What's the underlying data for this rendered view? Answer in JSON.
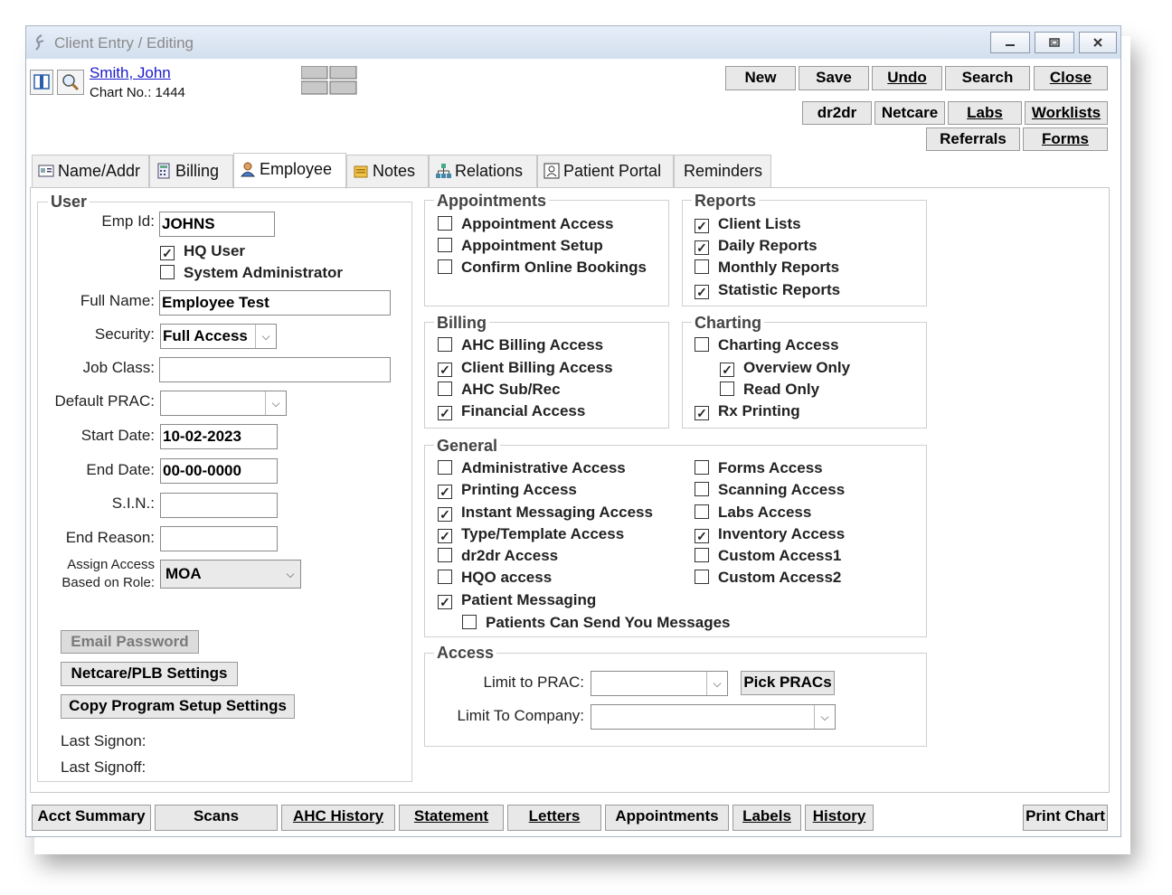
{
  "window": {
    "title": "Client Entry / Editing"
  },
  "client": {
    "name": "Smith, John",
    "chart_label": "Chart No.: 1444"
  },
  "toolbar": {
    "row1": [
      "New",
      "Save",
      "Undo",
      "Search",
      "Close"
    ],
    "row2": [
      "dr2dr",
      "Netcare",
      "Labs",
      "Worklists"
    ],
    "row3": [
      "Referrals",
      "Forms"
    ]
  },
  "tabs": [
    "Name/Addr",
    "Billing",
    "Employee",
    "Notes",
    "Relations",
    "Patient Portal",
    "Reminders"
  ],
  "user": {
    "title": "User",
    "emp_id_label": "Emp Id:",
    "emp_id": "JOHNS",
    "hq_user": "HQ User",
    "sys_admin": "System Administrator",
    "full_name_label": "Full Name:",
    "full_name": "Employee Test",
    "security_label": "Security:",
    "security": "Full Access",
    "job_class_label": "Job Class:",
    "job_class": "",
    "default_prac_label": "Default PRAC:",
    "default_prac": "",
    "start_date_label": "Start Date:",
    "start_date": "10-02-2023",
    "end_date_label": "End Date:",
    "end_date": "00-00-0000",
    "sin_label": "S.I.N.:",
    "sin": "",
    "end_reason_label": "End Reason:",
    "end_reason": "",
    "assign_label_1": "Assign Access",
    "assign_label_2": "Based on Role:",
    "role": "MOA",
    "email_password": "Email Password",
    "netcare_settings": "Netcare/PLB Settings",
    "copy_settings": "Copy Program Setup Settings",
    "last_signon": "Last Signon:",
    "last_signoff": "Last Signoff:"
  },
  "groups": {
    "appointments": {
      "title": "Appointments",
      "items": [
        {
          "label": "Appointment Access",
          "checked": false
        },
        {
          "label": "Appointment Setup",
          "checked": false
        },
        {
          "label": "Confirm Online Bookings",
          "checked": false
        }
      ]
    },
    "reports": {
      "title": "Reports",
      "items": [
        {
          "label": "Client Lists",
          "checked": true
        },
        {
          "label": "Daily Reports",
          "checked": true
        },
        {
          "label": "Monthly Reports",
          "checked": false
        },
        {
          "label": "Statistic Reports",
          "checked": true
        }
      ]
    },
    "billing": {
      "title": "Billing",
      "items": [
        {
          "label": "AHC Billing Access",
          "checked": false
        },
        {
          "label": "Client Billing Access",
          "checked": true
        },
        {
          "label": "AHC Sub/Rec",
          "checked": false
        },
        {
          "label": "Financial Access",
          "checked": true
        }
      ]
    },
    "charting": {
      "title": "Charting",
      "items": [
        {
          "label": "Charting Access",
          "checked": false
        },
        {
          "label": "Overview Only",
          "checked": true
        },
        {
          "label": "Read Only",
          "checked": false
        },
        {
          "label": "Rx Printing",
          "checked": true
        }
      ]
    },
    "general": {
      "title": "General",
      "left": [
        {
          "label": "Administrative Access",
          "checked": false
        },
        {
          "label": "Printing Access",
          "checked": true
        },
        {
          "label": "Instant Messaging Access",
          "checked": true
        },
        {
          "label": "Type/Template Access",
          "checked": true
        },
        {
          "label": "dr2dr Access",
          "checked": false
        },
        {
          "label": "HQO access",
          "checked": false
        },
        {
          "label": "Patient Messaging",
          "checked": true
        }
      ],
      "right": [
        {
          "label": "Forms Access",
          "checked": false
        },
        {
          "label": "Scanning Access",
          "checked": false
        },
        {
          "label": "Labs Access",
          "checked": false
        },
        {
          "label": "Inventory Access",
          "checked": true
        },
        {
          "label": "Custom Access1",
          "checked": false
        },
        {
          "label": "Custom Access2",
          "checked": false
        }
      ],
      "sub": {
        "label": "Patients Can Send You Messages",
        "checked": false
      }
    },
    "access": {
      "title": "Access",
      "limit_prac_label": "Limit to PRAC:",
      "limit_prac": "",
      "pick_pracs": "Pick PRACs",
      "limit_company_label": "Limit To Company:",
      "limit_company": ""
    }
  },
  "bottom": [
    "Acct Summary",
    "Scans",
    "AHC History",
    "Statement",
    "Letters",
    "Appointments",
    "Labels",
    "History",
    "Print Chart"
  ]
}
